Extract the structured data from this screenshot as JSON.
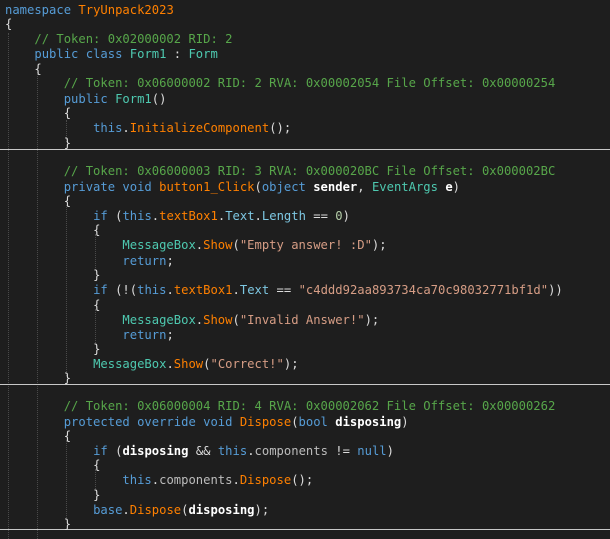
{
  "code": {
    "namespace_kw": "namespace",
    "namespace_name": "TryUnpack2023",
    "class_token": "// Token: 0x02000002 RID: 2",
    "class_decl_kw": "public class",
    "class_name": "Form1",
    "base_class": "Form",
    "ctor_token": "// Token: 0x06000002 RID: 2 RVA: 0x00002054 File Offset: 0x00000254",
    "ctor_kw": "public",
    "ctor_name": "Form1",
    "ctor_this": "this",
    "ctor_call": "InitializeComponent",
    "click_token": "// Token: 0x06000003 RID: 3 RVA: 0x000020BC File Offset: 0x000002BC",
    "click_kw": "private void",
    "click_name": "button1_Click",
    "click_p1_type": "object",
    "click_p1_name": "sender",
    "click_p2_type": "EventArgs",
    "click_p2_name": "e",
    "if_kw": "if",
    "this_kw": "this",
    "textbox_field": "textBox1",
    "text_prop": "Text",
    "length_prop": "Length",
    "zero_literal": "0",
    "msgbox_class": "MessageBox",
    "show_method": "Show",
    "empty_answer_str": "\"Empty answer! :D\"",
    "return_kw": "return",
    "hash_str": "\"c4ddd92aa893734ca70c98032771bf1d\"",
    "invalid_answer_str": "\"Invalid Answer!\"",
    "correct_str": "\"Correct!\"",
    "dispose_token": "// Token: 0x06000004 RID: 4 RVA: 0x00002062 File Offset: 0x00000262",
    "dispose_kw": "protected override void",
    "dispose_name": "Dispose",
    "bool_kw": "bool",
    "disposing_param": "disposing",
    "components_field": "components",
    "null_kw": "null",
    "base_kw": "base"
  }
}
